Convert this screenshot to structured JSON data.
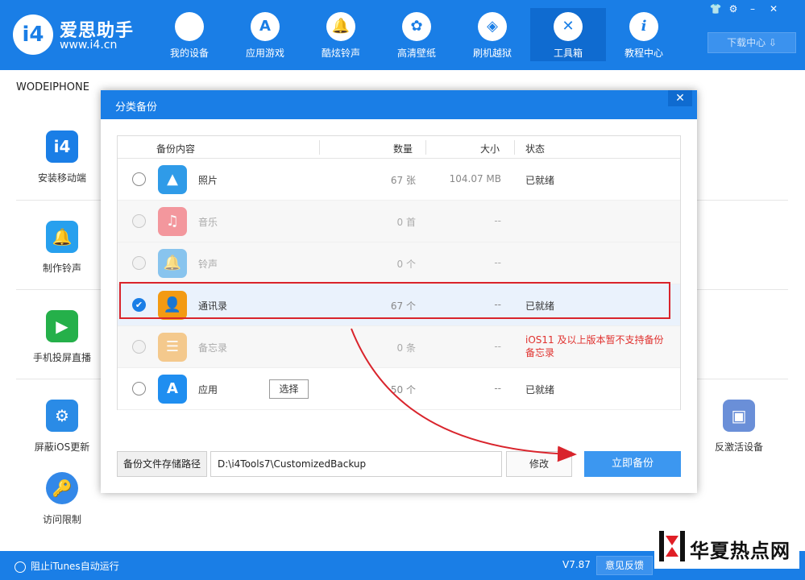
{
  "app": {
    "logo_mark": "i4",
    "title": "爱思助手",
    "url": "www.i4.cn"
  },
  "nav": [
    {
      "label": "我的设备",
      "icon": "apple-icon",
      "glyph": ""
    },
    {
      "label": "应用游戏",
      "icon": "app-store-icon",
      "glyph": "A"
    },
    {
      "label": "酷炫铃声",
      "icon": "bell-icon",
      "glyph": "🔔"
    },
    {
      "label": "高清壁纸",
      "icon": "flower-icon",
      "glyph": "✿"
    },
    {
      "label": "刷机越狱",
      "icon": "dropbox-icon",
      "glyph": "◈"
    },
    {
      "label": "工具箱",
      "icon": "tools-icon",
      "glyph": "✕"
    },
    {
      "label": "教程中心",
      "icon": "info-icon",
      "glyph": "i"
    }
  ],
  "window_controls": [
    "👕",
    "⚙",
    "–",
    "✕"
  ],
  "download_label": "下载中心 ⇩",
  "device_name": "WODEIPHONE",
  "tools": [
    {
      "label": "安装移动端",
      "glyph": "i4",
      "color": "#1a7ee6"
    },
    {
      "label": "制作铃声",
      "glyph": "🔔",
      "color": "#27a0ee"
    },
    {
      "label": "手机投屏直播",
      "glyph": "▶",
      "color": "#25b04a"
    },
    {
      "label": "屏蔽iOS更新",
      "glyph": "⚙",
      "color": "#2a8be6"
    },
    {
      "label": "访问限制",
      "glyph": "🔑",
      "color": "#3388e8"
    },
    {
      "label": "反激活设备",
      "glyph": "▣",
      "color": "#6a8fd8"
    }
  ],
  "modal": {
    "title": "分类备份",
    "close": "✕",
    "columns": {
      "content": "备份内容",
      "count": "数量",
      "size": "大小",
      "status": "状态"
    },
    "rows": [
      {
        "name": "照片",
        "count": "67 张",
        "size": "104.07 MB",
        "status": "已就绪",
        "glyph": "▲",
        "color": "#2f9be8"
      },
      {
        "name": "音乐",
        "count": "0 首",
        "size": "--",
        "status": "",
        "glyph": "♫",
        "color": "#f04a55"
      },
      {
        "name": "铃声",
        "count": "0 个",
        "size": "--",
        "status": "",
        "glyph": "🔔",
        "color": "#2f9be8"
      },
      {
        "name": "通讯录",
        "count": "67 个",
        "size": "--",
        "status": "已就绪",
        "glyph": "👤",
        "color": "#f39a12"
      },
      {
        "name": "备忘录",
        "count": "0 条",
        "size": "--",
        "status_line1": "iOS11 及以上版本暂不支持备份",
        "status_line2": "备忘录",
        "glyph": "☰",
        "color": "#f3a437"
      },
      {
        "name": "应用",
        "count": "50 个",
        "size": "--",
        "status": "已就绪",
        "glyph": "A",
        "color": "#1f8ef0",
        "action": "选择"
      }
    ],
    "path_label": "备份文件存储路径",
    "path_value": "D:\\i4Tools7\\CustomizedBackup",
    "modify_label": "修改",
    "backup_label": "立即备份"
  },
  "bottom": {
    "itunes_label": "阻止iTunes自动运行",
    "version": "V7.87",
    "feedback": "意见反馈"
  },
  "watermark": {
    "text": "华夏热点网"
  }
}
